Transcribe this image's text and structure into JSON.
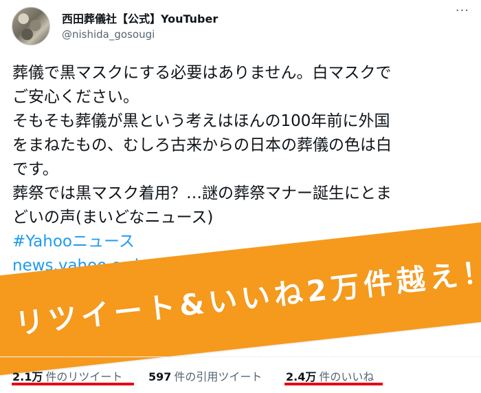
{
  "header": {
    "display_name": "西田葬儀社【公式】YouTuber",
    "handle": "@nishida_gosougi"
  },
  "tweet": {
    "lines": [
      "葬儀で黒マスクにする必要はありません。白マスクで",
      "ご安心ください。",
      "そもそも葬儀が黒という考えはほんの100年前に外国",
      "をまねたもの、むしろ古来からの日本の葬儀の色は白",
      "です。",
      "葬祭では黒マスク着用？…謎の葬祭マナー誕生にとま",
      "どいの声(まいどなニュース)"
    ],
    "hashtag": "#Yahooニュース",
    "link": "news.yahoo.co.jp/articles/26513"
  },
  "banner": {
    "text": "リツイート&いいね2万件越え！",
    "color": "#f59a1d"
  },
  "stats": {
    "retweets": {
      "count": "2.1万",
      "label": "件のリツイート"
    },
    "quotes": {
      "count": "597",
      "label": "件の引用ツイート"
    },
    "likes": {
      "count": "2.4万",
      "label": "件のいいね"
    }
  },
  "icons": [
    "more-icon"
  ],
  "colors": {
    "link": "#1d9bf0",
    "underline": "#e60012",
    "secondary_text": "#536471"
  }
}
